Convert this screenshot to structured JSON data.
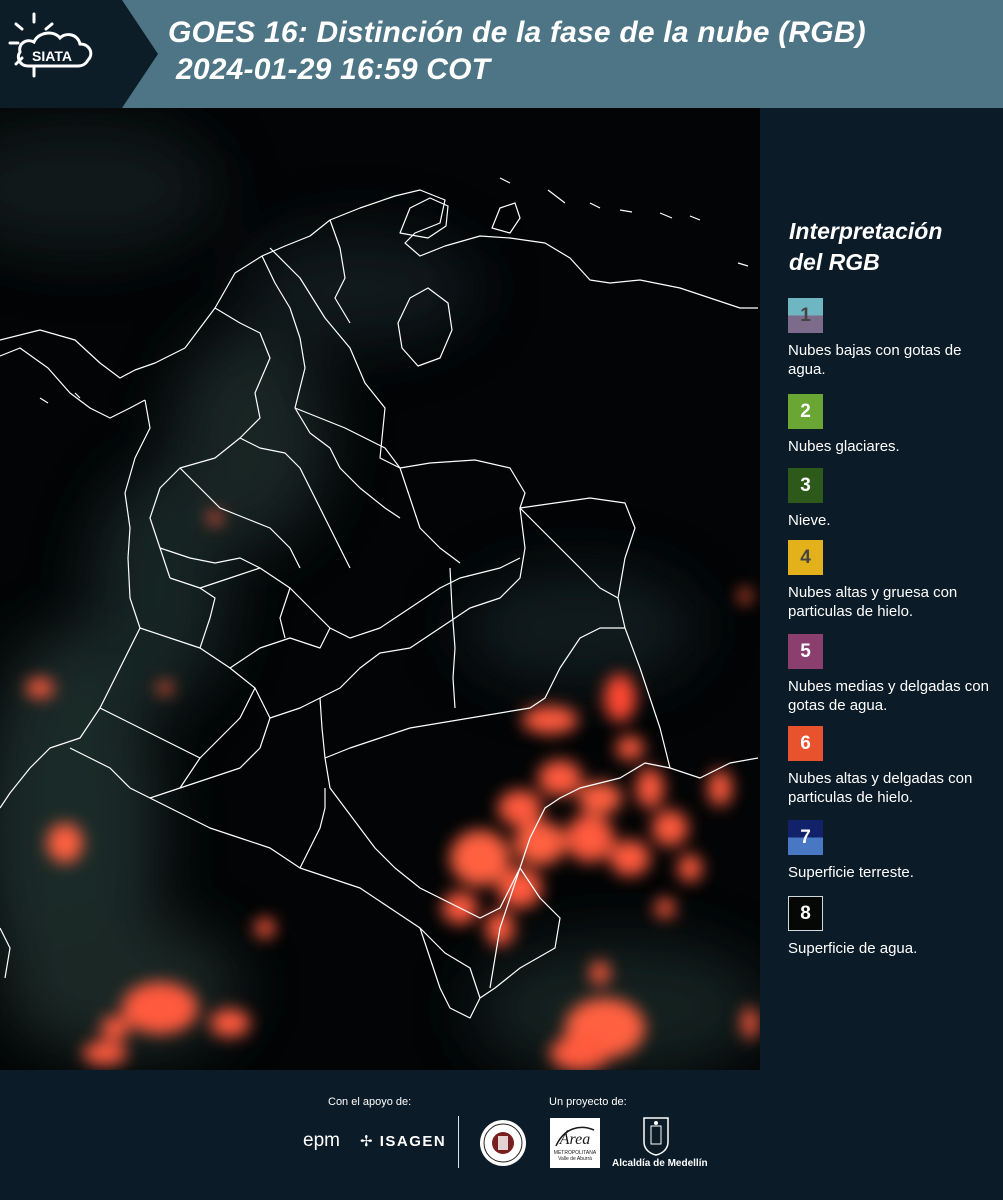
{
  "header": {
    "logo_text": "SIATA",
    "title_line1": "GOES 16: Distinción de la fase de la nube (RGB)",
    "title_line2": "2024-01-29 16:59 COT",
    "background_color": "#4e7585"
  },
  "legend": {
    "title_line1": "Interpretación",
    "title_line2": "del RGB",
    "items": [
      {
        "number": "1",
        "text": "Nubes bajas con gotas de agua.",
        "colors": [
          "#6fb6c3",
          "#7c6b8a"
        ],
        "number_color": "#444444"
      },
      {
        "number": "2",
        "text": "Nubes glaciares.",
        "colors": [
          "#6aa633"
        ],
        "number_color": "#ffffff"
      },
      {
        "number": "3",
        "text": "Nieve.",
        "colors": [
          "#2d5a1b"
        ],
        "number_color": "#ffffff"
      },
      {
        "number": "4",
        "text": "Nubes altas y gruesa con particulas de hielo.",
        "colors": [
          "#e3b21b"
        ],
        "number_color": "#444444"
      },
      {
        "number": "5",
        "text": "Nubes medias y delgadas con gotas de agua.",
        "colors": [
          "#8b3f6e"
        ],
        "number_color": "#ffffff"
      },
      {
        "number": "6",
        "text": "Nubes altas y delgadas con particulas de hielo.",
        "colors": [
          "#e8522d"
        ],
        "number_color": "#ffffff"
      },
      {
        "number": "7",
        "text": "Superficie terreste.",
        "colors": [
          "#11226b",
          "#4877c4"
        ],
        "number_color": "#ffffff"
      },
      {
        "number": "8",
        "text": "Superficie de agua.",
        "colors": [
          "#050805"
        ],
        "number_color": "#ffffff"
      }
    ]
  },
  "footer": {
    "support_label": "Con el apoyo de:",
    "project_label": "Un proyecto de:",
    "sponsors": [
      "epm",
      "ISAGEN"
    ],
    "partners": [
      "Área Metropolitana Valle de Aburrá",
      "Alcaldía de Medellín"
    ],
    "area_logo_text": "METROPOLITANA",
    "area_logo_subtext": "Valle de Aburrá",
    "alcaldia_label": "Alcaldía de Medellín"
  },
  "map": {
    "background_color": "#020405",
    "boundary_color": "#ffffff",
    "cloud_color": "#ff5a3c"
  }
}
